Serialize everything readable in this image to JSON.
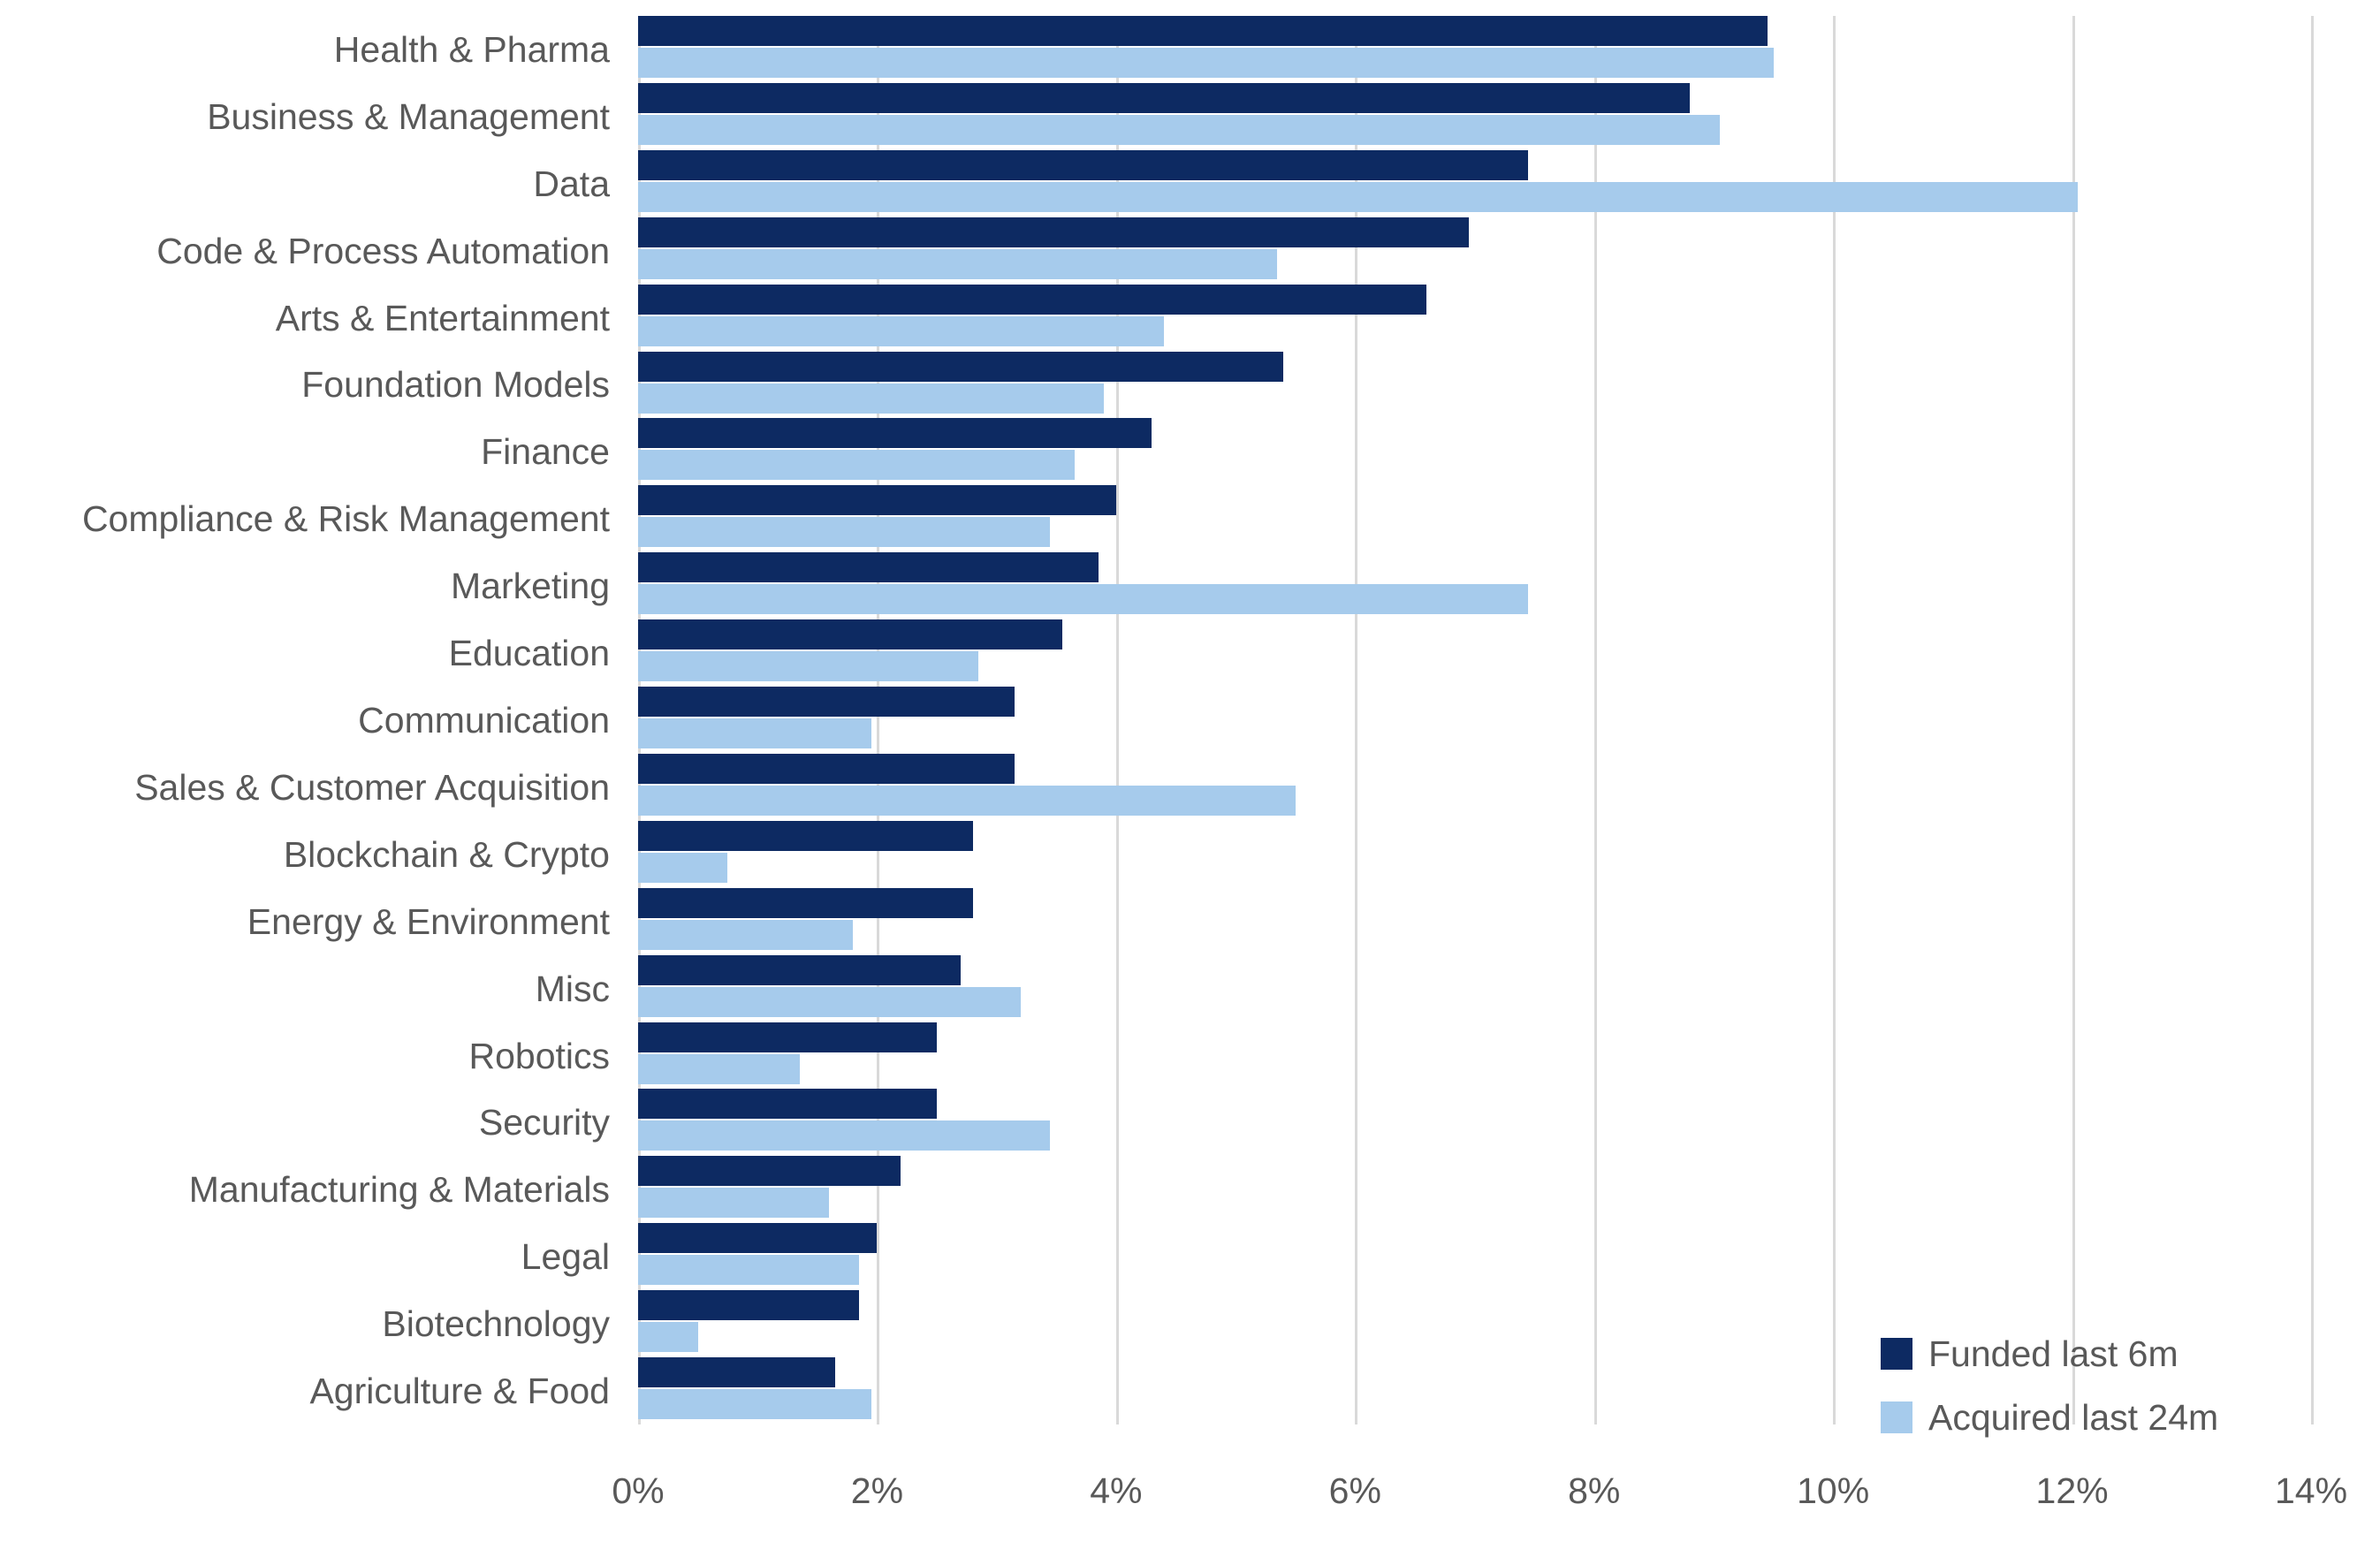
{
  "chart_data": {
    "type": "bar",
    "orientation": "horizontal",
    "title": "",
    "subtitle": "",
    "xlabel": "",
    "ylabel": "",
    "xlim": [
      0,
      14
    ],
    "xtick_labels": [
      "0%",
      "2%",
      "4%",
      "6%",
      "8%",
      "10%",
      "12%",
      "14%"
    ],
    "xtick_values": [
      0,
      2,
      4,
      6,
      8,
      10,
      12,
      14
    ],
    "grid": "vertical",
    "value_unit": "%",
    "legend_position": "bottom-right",
    "categories": [
      "Health & Pharma",
      "Business & Management",
      "Data",
      "Code & Process Automation",
      "Arts & Entertainment",
      "Foundation Models",
      "Finance",
      "Compliance & Risk Management",
      "Marketing",
      "Education",
      "Communication",
      "Sales & Customer Acquisition",
      "Blockchain & Crypto",
      "Energy & Environment",
      "Misc",
      "Robotics",
      "Security",
      "Manufacturing & Materials",
      "Legal",
      "Biotechnology",
      "Agriculture & Food"
    ],
    "series": [
      {
        "name": "Funded last 6m",
        "color": "#0d2a62",
        "values": [
          9.45,
          8.8,
          7.45,
          6.95,
          6.6,
          5.4,
          4.3,
          4.0,
          3.85,
          3.55,
          3.15,
          3.15,
          2.8,
          2.8,
          2.7,
          2.5,
          2.5,
          2.2,
          2.0,
          1.85,
          1.65
        ]
      },
      {
        "name": "Acquired last 24m",
        "color": "#a6cbec",
        "values": [
          9.5,
          9.05,
          12.05,
          5.35,
          4.4,
          3.9,
          3.65,
          3.45,
          7.45,
          2.85,
          1.95,
          5.5,
          0.75,
          1.8,
          3.2,
          1.35,
          3.45,
          1.6,
          1.85,
          0.5,
          1.95
        ]
      }
    ]
  },
  "legend": {
    "items": [
      {
        "label": "Funded last 6m",
        "color": "#0d2a62",
        "swatch": "funded"
      },
      {
        "label": "Acquired last 24m",
        "color": "#a6cbec",
        "swatch": "acquired"
      }
    ]
  },
  "colors": {
    "funded": "#0d2a62",
    "acquired": "#a6cbec",
    "gridline": "#d9d9d9",
    "text": "#595959",
    "background": "#ffffff"
  }
}
